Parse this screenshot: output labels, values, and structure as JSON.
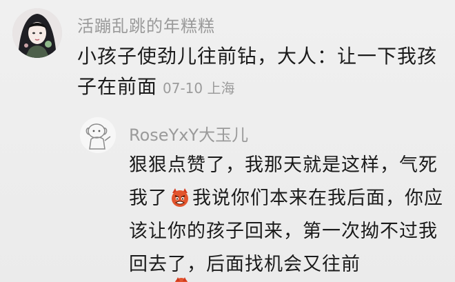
{
  "comment": {
    "username": "活蹦乱跳的年糕糕",
    "text": "小孩子使劲儿往前钻，大人：让一下我孩子在前面",
    "date": "07-10",
    "location": "上海"
  },
  "reply": {
    "username": "RoseYxY大玉儿",
    "text_before_emoji": "狠狠点赞了，我那天就是这样，气死我了",
    "emoji": "angry-devil-emoji",
    "text_after_emoji": "我说你们本来在我后面，你应该让你的孩子回来，第一次拗不过我回去了，后面找机会又往前"
  },
  "colors": {
    "background": "#ececec",
    "username": "#9a9a9a",
    "text": "#1b1b1b",
    "meta": "#9b9b9b"
  }
}
